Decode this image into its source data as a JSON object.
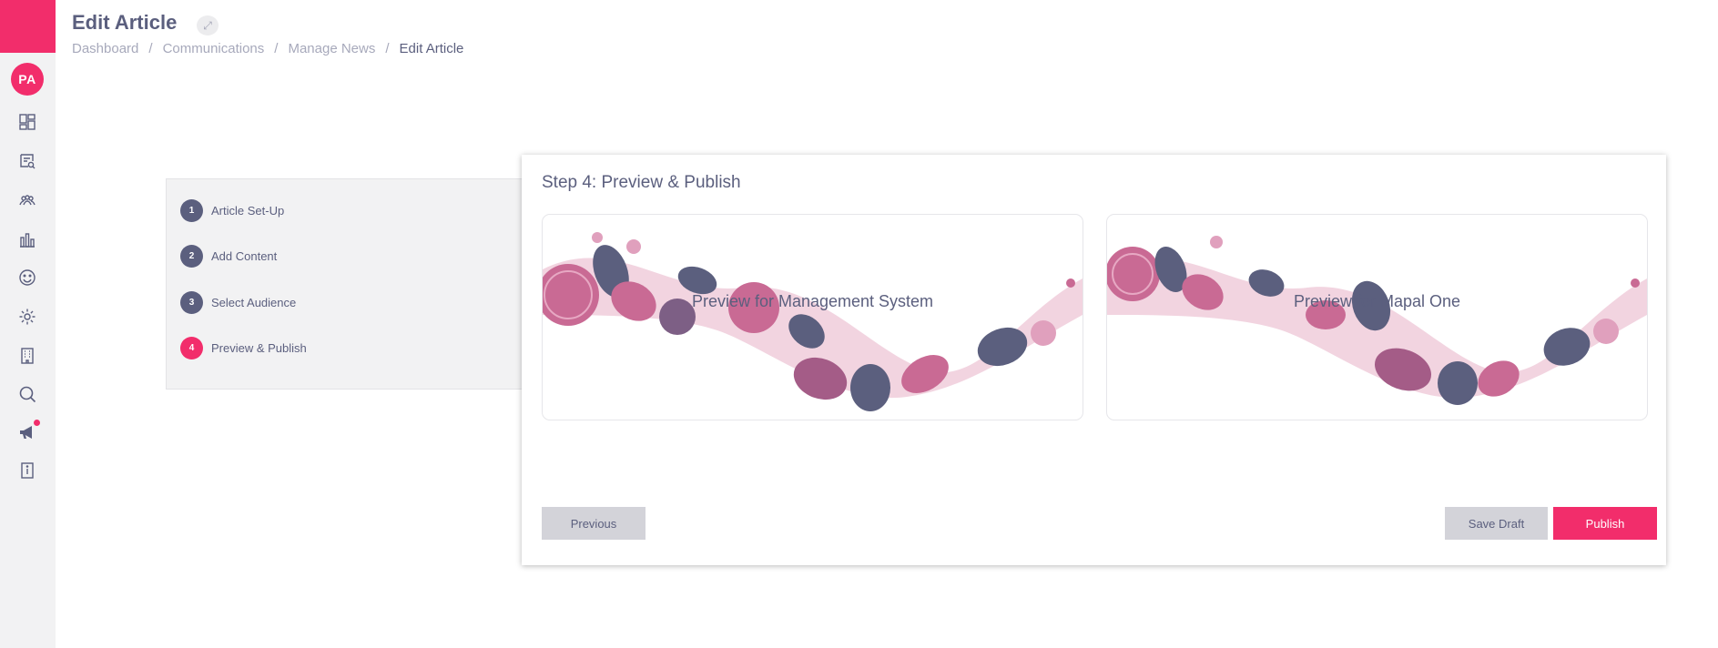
{
  "header": {
    "title": "Edit Article",
    "breadcrumb": [
      "Dashboard",
      "Communications",
      "Manage News",
      "Edit Article"
    ]
  },
  "sidebar": {
    "avatar": "PA",
    "brand_color": "#f22d6b",
    "icons": [
      "dashboard-icon",
      "search-document-icon",
      "audience-icon",
      "bar-chart-icon",
      "smiley-icon",
      "gear-icon",
      "building-icon",
      "search-icon",
      "megaphone-icon",
      "info-book-icon"
    ]
  },
  "steps": [
    {
      "number": "1",
      "label": "Article Set-Up"
    },
    {
      "number": "2",
      "label": "Add Content"
    },
    {
      "number": "3",
      "label": "Select Audience"
    },
    {
      "number": "4",
      "label": "Preview & Publish"
    }
  ],
  "card": {
    "title": "Step 4: Preview & Publish",
    "previews": [
      {
        "label": "Preview for Management System"
      },
      {
        "label": "Preview for Mapal One"
      }
    ],
    "buttons": {
      "previous": "Previous",
      "save_draft": "Save Draft",
      "publish": "Publish"
    }
  },
  "colors": {
    "accent": "#f22d6b",
    "text": "#5b5f7e",
    "muted": "#a7a9bb"
  }
}
